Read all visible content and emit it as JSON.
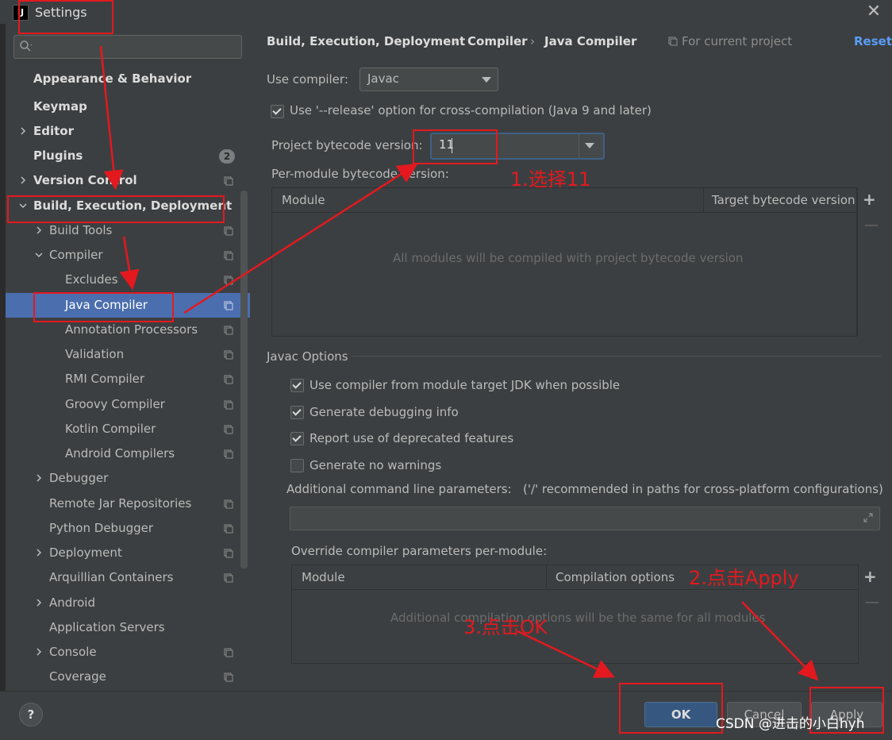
{
  "window": {
    "title": "Settings",
    "app_icon": "intellij-icon"
  },
  "sidebar": {
    "search_placeholder": "",
    "items": [
      {
        "label": "Appearance & Behavior",
        "bold": true
      },
      {
        "label": "Keymap",
        "bold": true
      },
      {
        "label": "Editor",
        "bold": true
      },
      {
        "label": "Plugins",
        "bold": true,
        "badge": "2"
      },
      {
        "label": "Version Control",
        "bold": true
      },
      {
        "label": "Build, Execution, Deployment",
        "bold": true
      },
      {
        "label": "Build Tools"
      },
      {
        "label": "Compiler"
      },
      {
        "label": "Excludes"
      },
      {
        "label": "Java Compiler",
        "selected": true
      },
      {
        "label": "Annotation Processors"
      },
      {
        "label": "Validation"
      },
      {
        "label": "RMI Compiler"
      },
      {
        "label": "Groovy Compiler"
      },
      {
        "label": "Kotlin Compiler"
      },
      {
        "label": "Android Compilers"
      },
      {
        "label": "Debugger"
      },
      {
        "label": "Remote Jar Repositories"
      },
      {
        "label": "Python Debugger"
      },
      {
        "label": "Deployment"
      },
      {
        "label": "Arquillian Containers"
      },
      {
        "label": "Android"
      },
      {
        "label": "Application Servers"
      },
      {
        "label": "Console"
      },
      {
        "label": "Coverage"
      }
    ]
  },
  "breadcrumb": {
    "items": [
      "Build, Execution, Deployment",
      "Compiler",
      "Java Compiler"
    ],
    "separator": "›",
    "scope": "For current project",
    "reset": "Reset"
  },
  "compiler": {
    "use_compiler_label": "Use compiler:",
    "use_compiler_value": "Javac",
    "release_option_label": "Use '--release' option for cross-compilation (Java 9 and later)",
    "release_option_checked": true,
    "bytecode_label": "Project bytecode version:",
    "bytecode_value": "11",
    "per_module_label": "Per-module bytecode version:",
    "module_table": {
      "col_module": "Module",
      "col_target": "Target bytecode version",
      "empty": "All modules will be compiled with project bytecode version"
    }
  },
  "javac": {
    "section_title": "Javac Options",
    "options": [
      {
        "label": "Use compiler from module target JDK when possible",
        "checked": true
      },
      {
        "label": "Generate debugging info",
        "checked": true
      },
      {
        "label": "Report use of deprecated features",
        "checked": true
      },
      {
        "label": "Generate no warnings",
        "checked": false
      }
    ],
    "cmdline_label": "Additional command line parameters:",
    "cmdline_hint": "('/' recommended in paths for cross-platform configurations)",
    "cmdline_value": "",
    "override_label": "Override compiler parameters per-module:",
    "override_table": {
      "col_module": "Module",
      "col_options": "Compilation options",
      "empty": "Additional compilation options will be the same for all modules"
    }
  },
  "buttons": {
    "help": "?",
    "ok": "OK",
    "cancel": "Cancel",
    "apply": "Apply"
  },
  "annotations": {
    "step1": "1.选择11",
    "step2": "2.点击Apply",
    "step3": "3.点击OK",
    "color": "#e3191f"
  },
  "watermark": "CSDN @进击的小白hyh",
  "colors": {
    "selection": "#4b6eaf",
    "link": "#589df6",
    "ok_button": "#365880"
  }
}
